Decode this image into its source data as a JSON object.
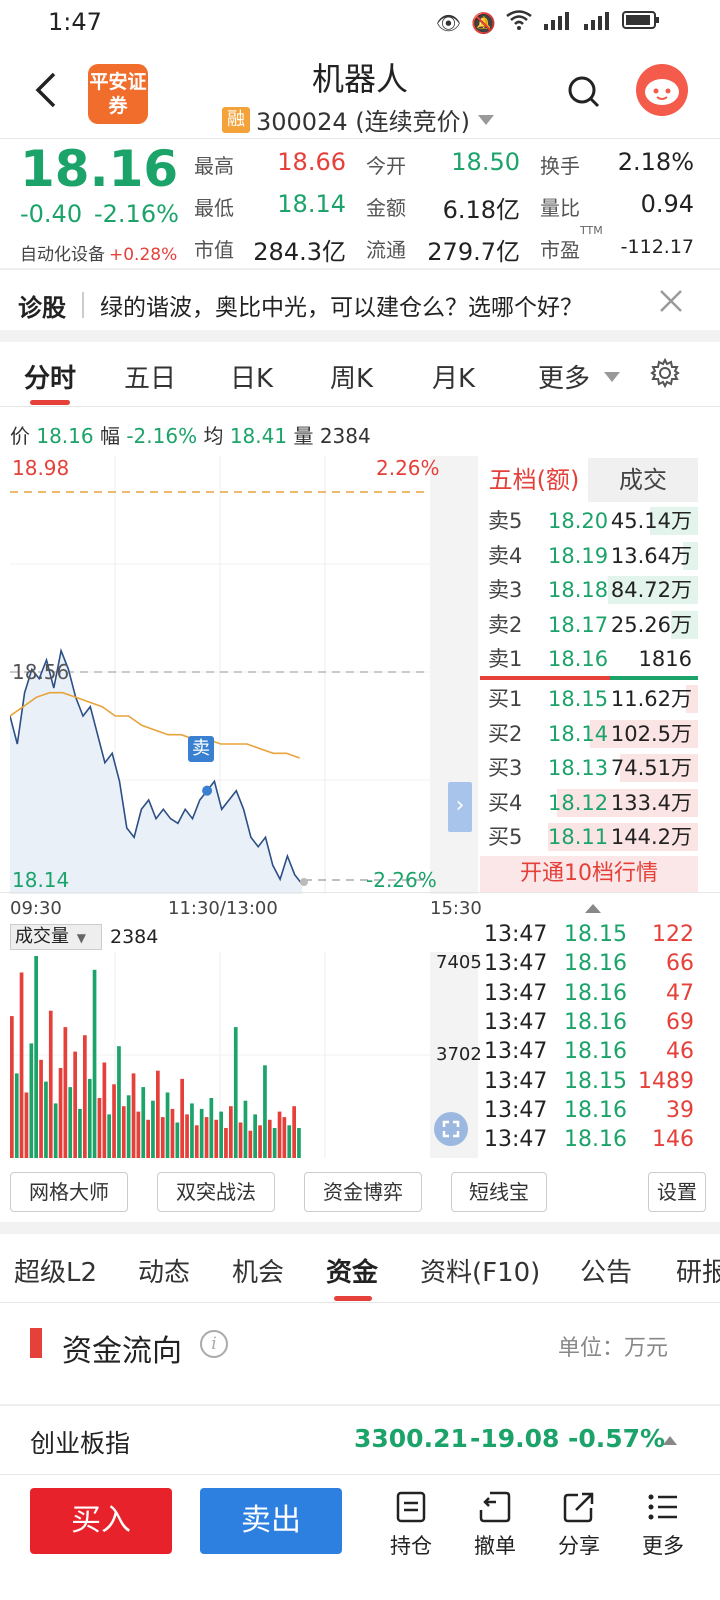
{
  "status": {
    "time": "1:47"
  },
  "header": {
    "title": "机器人",
    "logo_text": "平安证券",
    "rong_badge": "融",
    "code_text": "300024 (连续竞价)"
  },
  "quote": {
    "price": "18.16",
    "change": "-0.40",
    "change_pct": "-2.16%",
    "sector_name": "自动化设备",
    "sector_change": "+0.28%",
    "fields": [
      {
        "label": "最高",
        "value": "18.66",
        "color": "red"
      },
      {
        "label": "今开",
        "value": "18.50",
        "color": "green"
      },
      {
        "label": "换手",
        "value": "2.18%",
        "color": "dark"
      },
      {
        "label": "最低",
        "value": "18.14",
        "color": "green"
      },
      {
        "label": "金额",
        "value": "6.18亿",
        "color": "dark"
      },
      {
        "label": "量比",
        "value": "0.94",
        "color": "dark"
      },
      {
        "label": "市值",
        "value": "284.3亿",
        "color": "dark"
      },
      {
        "label": "流通",
        "value": "279.7亿",
        "color": "dark"
      },
      {
        "label": "市盈",
        "value": "-112.17",
        "color": "dark",
        "superscript": "TTM"
      }
    ]
  },
  "diagnosis": {
    "label": "诊股",
    "text": "绿的谐波，奥比中光，可以建仓么？选哪个好？"
  },
  "chart_tabs": [
    "分时",
    "五日",
    "日K",
    "周K",
    "月K",
    "更多"
  ],
  "info_line": {
    "price_label": "价",
    "price": "18.16",
    "range_label": "幅",
    "range": "-2.16%",
    "avg_label": "均",
    "avg": "18.41",
    "vol_label": "量",
    "vol": "2384"
  },
  "intraday": {
    "top_price": "18.98",
    "top_pct": "2.26%",
    "mid_price": "18.56",
    "bottom_price": "18.14",
    "bottom_pct": "-2.26%",
    "sell_marker": "卖",
    "time_labels": [
      "09:30",
      "11:30/13:00",
      "15:30"
    ]
  },
  "chart_data": {
    "type": "line",
    "ylim": [
      18.14,
      18.98
    ],
    "series": [
      {
        "name": "价",
        "values": [
          18.5,
          18.44,
          18.55,
          18.6,
          18.58,
          18.62,
          18.56,
          18.64,
          18.6,
          18.54,
          18.5,
          18.52,
          18.46,
          18.4,
          18.42,
          18.36,
          18.26,
          18.24,
          18.3,
          18.32,
          18.28,
          18.3,
          18.28,
          18.27,
          18.3,
          18.28,
          18.32,
          18.34,
          18.36,
          18.3,
          18.32,
          18.34,
          18.3,
          18.24,
          18.22,
          18.24,
          18.18,
          18.15,
          18.2,
          18.16,
          18.14
        ]
      },
      {
        "name": "均",
        "values": [
          18.5,
          18.52,
          18.54,
          18.55,
          18.55,
          18.54,
          18.53,
          18.52,
          18.5,
          18.5,
          18.48,
          18.47,
          18.46,
          18.46,
          18.45,
          18.45,
          18.44,
          18.44,
          18.44,
          18.43,
          18.42,
          18.42,
          18.41
        ]
      }
    ],
    "volume": {
      "max_label": "7405",
      "mid_label": "3702",
      "value_label": "2384",
      "values": [
        5200,
        3100,
        6800,
        2400,
        4200,
        7405,
        3600,
        2800,
        5400,
        2000,
        3300,
        4800,
        2600,
        3900,
        1800,
        4500,
        2900,
        6900,
        2200,
        3500,
        1600,
        2700,
        4100,
        1900,
        2300,
        3100,
        1700,
        2600,
        1400,
        2100,
        3200,
        1500,
        2400,
        1800,
        1300,
        2900,
        1600,
        2000,
        1200,
        1800,
        1500,
        2200,
        1400,
        1700,
        1100,
        1900,
        4800,
        1300,
        2100,
        1000,
        1600,
        1200,
        3400,
        1400,
        1100,
        1700,
        1500,
        1200,
        1900,
        1100
      ],
      "colors": [
        "r",
        "g",
        "r",
        "r",
        "g",
        "g",
        "r",
        "g",
        "r",
        "g",
        "r",
        "r",
        "g",
        "r",
        "g",
        "r",
        "g",
        "g",
        "r",
        "r",
        "g",
        "r",
        "g",
        "r",
        "g",
        "r",
        "r",
        "g",
        "r",
        "g",
        "r",
        "r",
        "g",
        "r",
        "g",
        "r",
        "r",
        "g",
        "r",
        "g",
        "r",
        "g",
        "r",
        "g",
        "r",
        "r",
        "g",
        "r",
        "g",
        "r",
        "g",
        "r",
        "g",
        "r",
        "g",
        "r",
        "r",
        "g",
        "r",
        "g"
      ]
    }
  },
  "order_book": {
    "tab_active": "五档(额)",
    "tab_other": "成交",
    "asks": [
      {
        "label": "卖5",
        "price": "18.20",
        "volume": "45.14万",
        "bar": 0.32
      },
      {
        "label": "卖4",
        "price": "18.19",
        "volume": "13.64万",
        "bar": 0.1
      },
      {
        "label": "卖3",
        "price": "18.18",
        "volume": "84.72万",
        "bar": 0.6
      },
      {
        "label": "卖2",
        "price": "18.17",
        "volume": "25.26万",
        "bar": 0.18
      },
      {
        "label": "卖1",
        "price": "18.16",
        "volume": "1816",
        "bar": 0.0
      }
    ],
    "bids": [
      {
        "label": "买1",
        "price": "18.15",
        "volume": "11.62万",
        "bar": 0.08
      },
      {
        "label": "买2",
        "price": "18.14",
        "volume": "102.5万",
        "bar": 0.72
      },
      {
        "label": "买3",
        "price": "18.13",
        "volume": "74.51万",
        "bar": 0.52
      },
      {
        "label": "买4",
        "price": "18.12",
        "volume": "133.4万",
        "bar": 0.94
      },
      {
        "label": "买5",
        "price": "18.11",
        "volume": "144.2万",
        "bar": 1.0
      }
    ],
    "upgrade_text": "开通10档行情"
  },
  "trades": [
    {
      "time": "13:47",
      "price": "18.15",
      "qty": "122"
    },
    {
      "time": "13:47",
      "price": "18.16",
      "qty": "66"
    },
    {
      "time": "13:47",
      "price": "18.16",
      "qty": "47"
    },
    {
      "time": "13:47",
      "price": "18.16",
      "qty": "69"
    },
    {
      "time": "13:47",
      "price": "18.16",
      "qty": "46"
    },
    {
      "time": "13:47",
      "price": "18.15",
      "qty": "1489"
    },
    {
      "time": "13:47",
      "price": "18.16",
      "qty": "39"
    },
    {
      "time": "13:47",
      "price": "18.16",
      "qty": "146"
    }
  ],
  "volume_selector": "成交量",
  "tools": [
    "网格大师",
    "双突战法",
    "资金博弈",
    "短线宝",
    "设置"
  ],
  "bottom_tabs": [
    "超级L2",
    "动态",
    "机会",
    "资金",
    "资料(F10)",
    "公告",
    "研报"
  ],
  "fund_flow": {
    "title": "资金流向",
    "info": "i",
    "unit": "单位：万元"
  },
  "index_row": {
    "name": "创业板指",
    "value": "3300.21",
    "change": "-19.08",
    "pct": "-0.57%"
  },
  "actions": {
    "buy": "买入",
    "sell": "卖出"
  },
  "nav": [
    "持仓",
    "撤单",
    "分享",
    "更多"
  ],
  "colors": {
    "up": "#e5403a",
    "down": "#1ba36a",
    "accent": "#2d7fe0",
    "avg_line": "#e8a33c"
  }
}
